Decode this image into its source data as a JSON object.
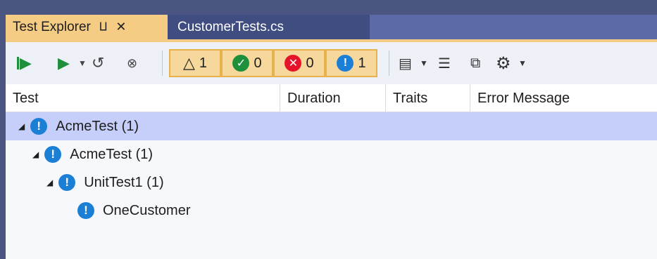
{
  "tabs": {
    "active_label": "Test Explorer",
    "inactive_label": "CustomerTests.cs",
    "pin_icon": "⨿",
    "close_icon": "✕"
  },
  "toolbar": {
    "counters": [
      {
        "name": "total",
        "icon": "flask-icon",
        "value": "1"
      },
      {
        "name": "passed",
        "icon": "check-circle-icon",
        "value": "0"
      },
      {
        "name": "failed",
        "icon": "x-circle-icon",
        "value": "0"
      },
      {
        "name": "not-run",
        "icon": "info-circle-icon",
        "value": "1"
      }
    ]
  },
  "columns": {
    "test": "Test",
    "duration": "Duration",
    "traits": "Traits",
    "error": "Error Message"
  },
  "tree": {
    "rows": [
      {
        "label": "AcmeTest (1)"
      },
      {
        "label": "AcmeTest (1)"
      },
      {
        "label": "UnitTest1 (1)"
      },
      {
        "label": "OneCustomer"
      }
    ]
  },
  "colors": {
    "accent": "#f5cc84",
    "pass": "#1e8f3a",
    "fail": "#e5142b",
    "info": "#1c7fd6",
    "selection": "#c6cffa"
  }
}
